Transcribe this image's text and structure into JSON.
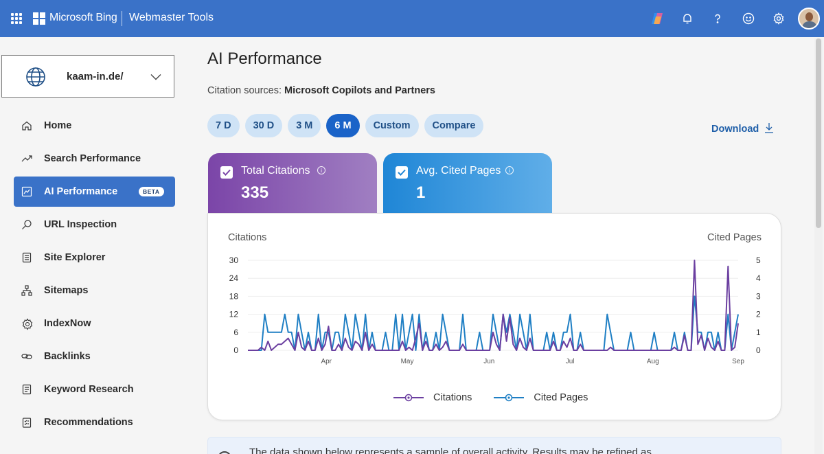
{
  "header": {
    "brand": "Microsoft Bing",
    "product": "Webmaster Tools"
  },
  "site_selector": {
    "value": "kaam-in.de/"
  },
  "sidebar": {
    "items": [
      {
        "label": "Home",
        "icon": "home-icon"
      },
      {
        "label": "Search Performance",
        "icon": "trend-icon"
      },
      {
        "label": "AI Performance",
        "icon": "ai-chart-icon",
        "active": true,
        "badge": "BETA"
      },
      {
        "label": "URL Inspection",
        "icon": "magnifier-icon"
      },
      {
        "label": "Site Explorer",
        "icon": "document-icon"
      },
      {
        "label": "Sitemaps",
        "icon": "sitemap-icon"
      },
      {
        "label": "IndexNow",
        "icon": "gear-icon"
      },
      {
        "label": "Backlinks",
        "icon": "link-icon"
      },
      {
        "label": "Keyword Research",
        "icon": "document-icon"
      },
      {
        "label": "Recommendations",
        "icon": "clipboard-icon"
      }
    ]
  },
  "main": {
    "title": "AI Performance",
    "citation_label": "Citation sources:",
    "citation_value": "Microsoft Copilots and Partners",
    "ranges": [
      "7 D",
      "30 D",
      "3 M",
      "6 M",
      "Custom",
      "Compare"
    ],
    "active_range": "6 M",
    "download_label": "Download",
    "cards": [
      {
        "title": "Total Citations",
        "value": "335"
      },
      {
        "title": "Avg. Cited Pages",
        "value": "1"
      }
    ],
    "notice": "The data shown below represents a sample of overall activity. Results may be refined as"
  },
  "colors": {
    "header": "#3a72c8",
    "citations": "#6b3fa0",
    "cited_pages": "#1f7fc4",
    "active_pill": "#1a63c8"
  },
  "chart_data": {
    "type": "line",
    "ylabel_left": "Citations",
    "ylabel_right": "Cited Pages",
    "y_left_ticks": [
      0,
      6,
      12,
      18,
      24,
      30
    ],
    "y_right_ticks": [
      0,
      1,
      2,
      3,
      4,
      5
    ],
    "ylim_left": [
      0,
      30
    ],
    "ylim_right": [
      0,
      5
    ],
    "x_labels": [
      "Apr",
      "May",
      "Jun",
      "Jul",
      "Aug",
      "Sep"
    ],
    "legend": [
      "Citations",
      "Cited Pages"
    ],
    "legend_position": "bottom",
    "series": [
      {
        "name": "Citations",
        "axis": "left",
        "values": [
          0,
          0,
          0,
          0,
          1,
          0,
          3,
          0,
          1,
          2,
          2,
          3,
          4,
          2,
          0,
          6,
          1,
          0,
          3,
          0,
          0,
          4,
          0,
          2,
          8,
          0,
          0,
          2,
          0,
          4,
          1,
          0,
          3,
          2,
          0,
          6,
          0,
          2,
          0,
          0,
          0,
          0,
          0,
          0,
          0,
          0,
          3,
          0,
          1,
          0,
          4,
          9,
          0,
          3,
          0,
          0,
          2,
          0,
          1,
          3,
          0,
          0,
          0,
          0,
          2,
          0,
          0,
          0,
          0,
          0,
          0,
          0,
          0,
          6,
          2,
          0,
          12,
          3,
          11,
          2,
          0,
          4,
          1,
          0,
          4,
          0,
          0,
          0,
          0,
          0,
          0,
          3,
          0,
          0,
          3,
          1,
          4,
          0,
          0,
          2,
          0,
          0,
          0,
          0,
          0,
          0,
          0,
          0,
          1,
          0,
          0,
          0,
          0,
          0,
          0,
          0,
          0,
          0,
          0,
          0,
          0,
          0,
          0,
          0,
          0,
          0,
          0,
          1,
          0,
          0,
          5,
          0,
          0,
          30,
          2,
          5,
          0,
          4,
          1,
          0,
          3,
          0,
          0,
          28,
          0,
          1,
          9
        ]
      },
      {
        "name": "Cited Pages",
        "axis": "right",
        "values": [
          0,
          0,
          0,
          0,
          0,
          2,
          1,
          1,
          1,
          1,
          1,
          2,
          1,
          1,
          0,
          2,
          1,
          0,
          1,
          0,
          0,
          2,
          0,
          1,
          1,
          0,
          1,
          1,
          0,
          2,
          1,
          0,
          2,
          1,
          0,
          2,
          0,
          1,
          0,
          0,
          0,
          1,
          0,
          0,
          2,
          0,
          2,
          0,
          1,
          2,
          0,
          2,
          0,
          1,
          0,
          0,
          1,
          0,
          2,
          1,
          0,
          0,
          0,
          0,
          2,
          0,
          0,
          0,
          0,
          1,
          0,
          0,
          0,
          2,
          1,
          0,
          2,
          1,
          2,
          1,
          0,
          2,
          1,
          0,
          2,
          0,
          0,
          0,
          0,
          1,
          0,
          1,
          0,
          0,
          1,
          1,
          2,
          0,
          0,
          1,
          0,
          0,
          0,
          0,
          0,
          0,
          0,
          2,
          1,
          0,
          0,
          0,
          0,
          0,
          1,
          0,
          0,
          0,
          0,
          0,
          0,
          1,
          0,
          0,
          0,
          0,
          0,
          1,
          0,
          0,
          1,
          0,
          0,
          3,
          1,
          1,
          0,
          1,
          1,
          0,
          1,
          0,
          0,
          2,
          0,
          1,
          2
        ]
      }
    ]
  }
}
